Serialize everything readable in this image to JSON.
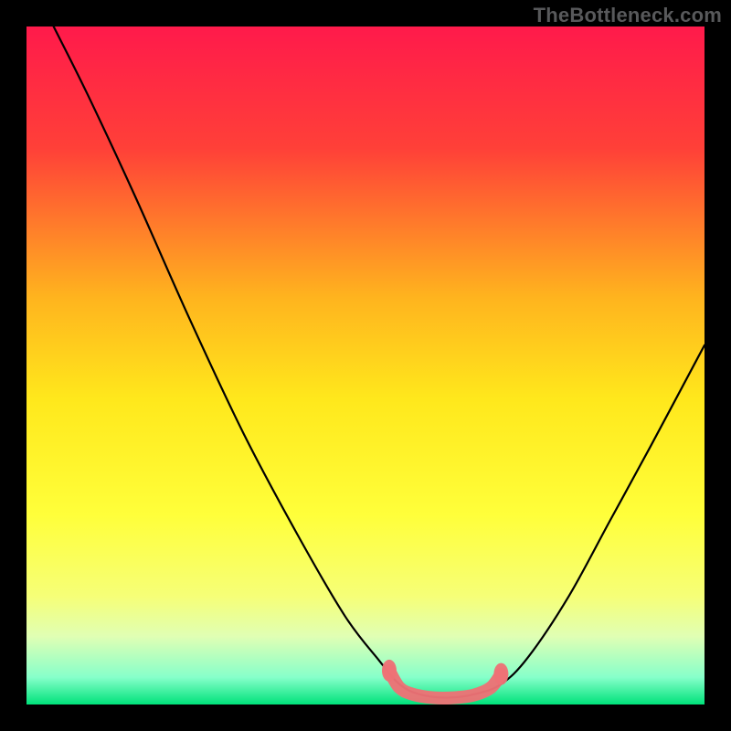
{
  "watermark": "TheBottleneck.com",
  "chart_data": {
    "type": "line",
    "title": "",
    "xlabel": "",
    "ylabel": "",
    "xlim": [
      0,
      100
    ],
    "ylim": [
      0,
      100
    ],
    "gradient_stops": [
      {
        "offset": 0,
        "color": "#ff1a4b"
      },
      {
        "offset": 0.18,
        "color": "#ff4038"
      },
      {
        "offset": 0.4,
        "color": "#ffb41e"
      },
      {
        "offset": 0.55,
        "color": "#ffe81c"
      },
      {
        "offset": 0.72,
        "color": "#ffff3a"
      },
      {
        "offset": 0.84,
        "color": "#f6ff77"
      },
      {
        "offset": 0.9,
        "color": "#e0ffb4"
      },
      {
        "offset": 0.96,
        "color": "#86ffca"
      },
      {
        "offset": 1.0,
        "color": "#00e27a"
      }
    ],
    "series": [
      {
        "name": "bottleneck-curve",
        "stroke": "#000000",
        "points": [
          {
            "x": 4.0,
            "y": 100.0
          },
          {
            "x": 9.0,
            "y": 90.0
          },
          {
            "x": 16.0,
            "y": 75.0
          },
          {
            "x": 24.0,
            "y": 57.0
          },
          {
            "x": 32.0,
            "y": 40.0
          },
          {
            "x": 40.0,
            "y": 25.0
          },
          {
            "x": 47.0,
            "y": 13.0
          },
          {
            "x": 52.0,
            "y": 6.5
          },
          {
            "x": 55.0,
            "y": 3.0
          },
          {
            "x": 58.0,
            "y": 1.5
          },
          {
            "x": 62.0,
            "y": 1.0
          },
          {
            "x": 66.0,
            "y": 1.5
          },
          {
            "x": 70.0,
            "y": 3.0
          },
          {
            "x": 74.0,
            "y": 7.0
          },
          {
            "x": 80.0,
            "y": 16.0
          },
          {
            "x": 86.0,
            "y": 27.0
          },
          {
            "x": 92.0,
            "y": 38.0
          },
          {
            "x": 100.0,
            "y": 53.0
          }
        ]
      },
      {
        "name": "pink-overlay",
        "stroke": "#ed7176",
        "points": [
          {
            "x": 53.5,
            "y": 5.0
          },
          {
            "x": 55.0,
            "y": 2.5
          },
          {
            "x": 57.0,
            "y": 1.5
          },
          {
            "x": 60.0,
            "y": 1.0
          },
          {
            "x": 63.0,
            "y": 1.0
          },
          {
            "x": 66.0,
            "y": 1.4
          },
          {
            "x": 68.5,
            "y": 2.5
          },
          {
            "x": 70.0,
            "y": 4.5
          }
        ]
      }
    ]
  }
}
